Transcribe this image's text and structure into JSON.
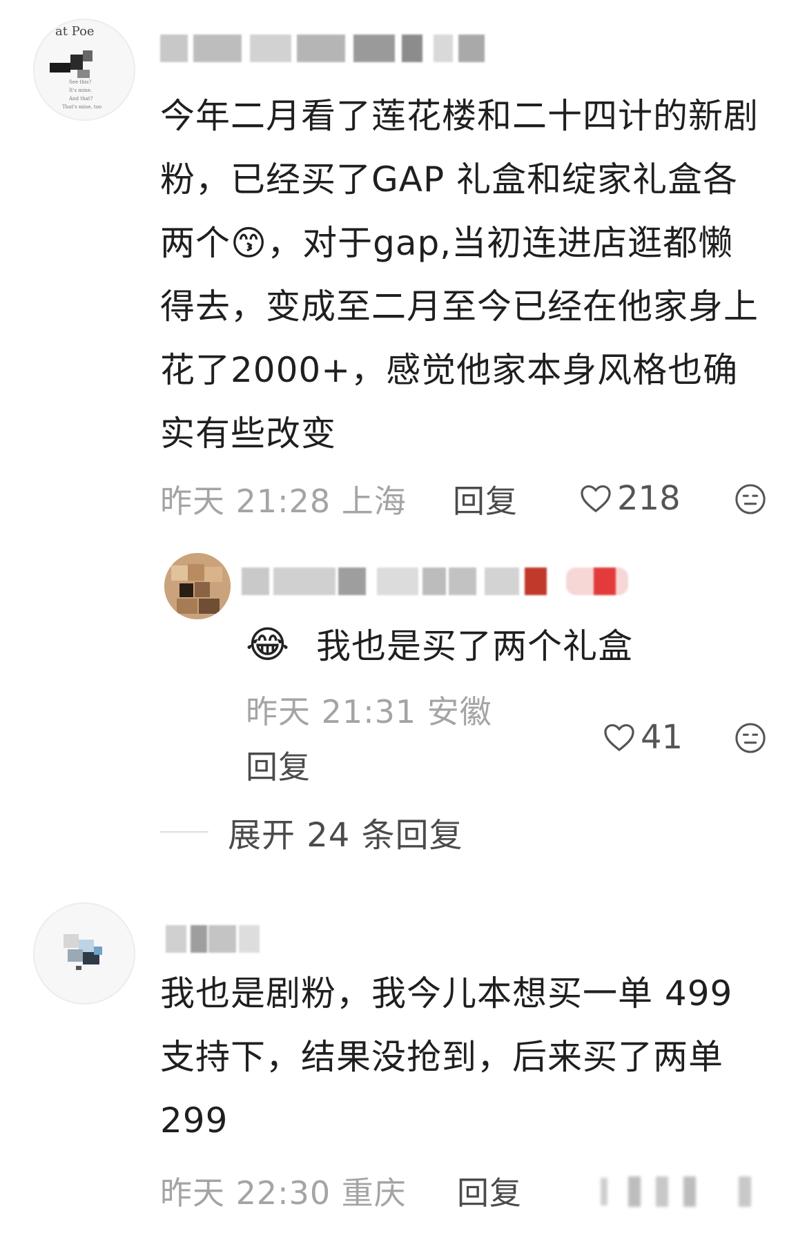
{
  "comments": [
    {
      "text": "今年二月看了莲花楼和二十四计的新剧粉，已经买了GAP 礼盒和绽家礼盒各两个😙，对于gap,当初连进店逛都懒得去，变成至二月至今已经在他家身上花了2000+，感觉他家本身风格也确实有些改变",
      "date": "昨天 21:28 上海",
      "reply_label": "回复",
      "likes": "218",
      "reply": {
        "emoji": "😂",
        "text": "我也是买了两个礼盒",
        "date": "昨天 21:31 安徽",
        "reply_label": "回复",
        "likes": "41"
      },
      "expand_label": "展开 24 条回复"
    },
    {
      "text": "我也是剧粉，我今儿本想买一单 499 支持下，结果没抢到，后来买了两单 299",
      "date": "昨天 22:30 重庆",
      "reply_label": "回复"
    }
  ],
  "icons": {
    "like": "heart-outline-icon",
    "dislike": "meh-face-icon"
  }
}
